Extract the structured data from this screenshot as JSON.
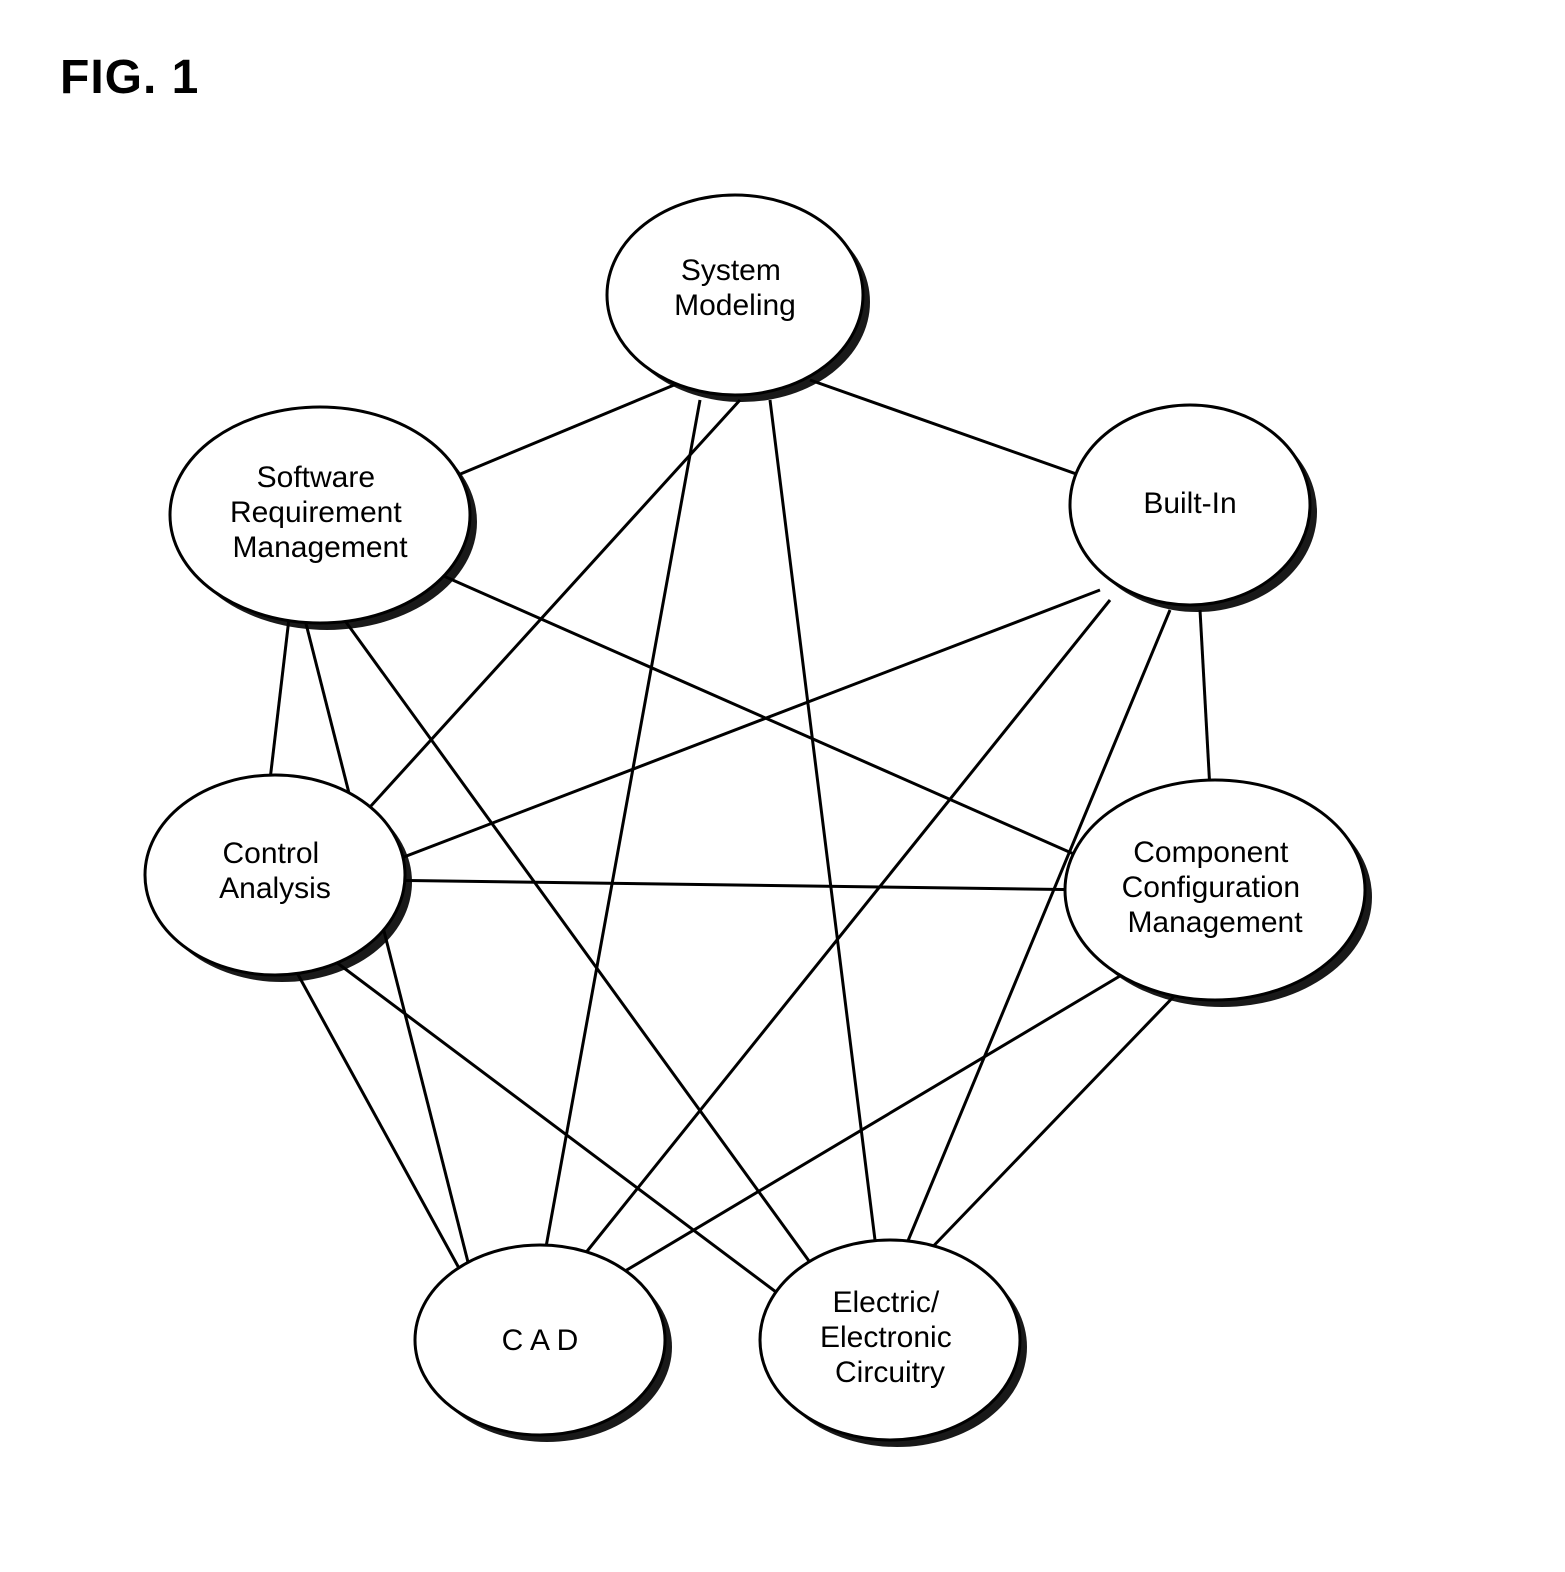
{
  "figure_label": "FIG. 1",
  "nodes": {
    "system_modeling": {
      "l1": "System",
      "l2": "Modeling"
    },
    "built_in": {
      "l1": "Built-In"
    },
    "component_config": {
      "l1": "Component",
      "l2": "Configuration",
      "l3": "Management"
    },
    "electric": {
      "l1": "Electric/",
      "l2": "Electronic",
      "l3": "Circuitry"
    },
    "cad": {
      "l1": "C A D"
    },
    "control_analysis": {
      "l1": "Control",
      "l2": "Analysis"
    },
    "software_req": {
      "l1": "Software",
      "l2": "Requirement",
      "l3": "Management"
    }
  }
}
